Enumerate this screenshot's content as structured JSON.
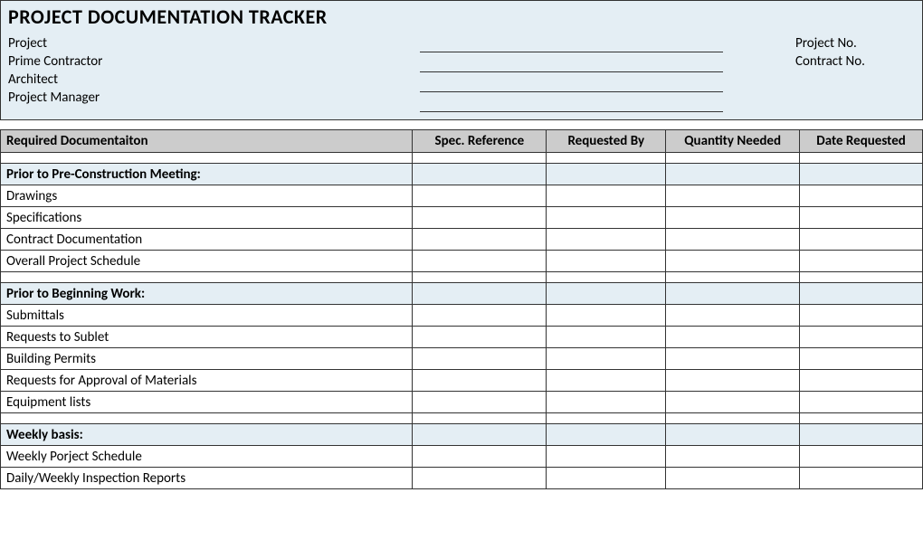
{
  "header": {
    "title": "PROJECT DOCUMENTATION TRACKER",
    "labels": {
      "project": "Project",
      "prime_contractor": "Prime Contractor",
      "architect": "Architect",
      "project_manager": "Project Manager",
      "project_no": "Project No.",
      "contract_no": "Contract No."
    },
    "values": {
      "project": "",
      "prime_contractor": "",
      "architect": "",
      "project_manager": "",
      "project_no": "",
      "contract_no": ""
    }
  },
  "columns": {
    "doc": "Required Documentaiton",
    "spec": "Spec. Reference",
    "reqby": "Requested By",
    "qty": "Quantity Needed",
    "date": "Date Requested"
  },
  "sections": [
    {
      "heading": "Prior to Pre-Construction Meeting:",
      "items": [
        "Drawings",
        "Specifications",
        "Contract Documentation",
        "Overall Project Schedule"
      ]
    },
    {
      "heading": "Prior to Beginning Work:",
      "items": [
        "Submittals",
        "Requests to Sublet",
        "Building Permits",
        "Requests for Approval of Materials",
        "Equipment lists"
      ]
    },
    {
      "heading": "Weekly basis:",
      "items": [
        "Weekly Porject Schedule",
        "Daily/Weekly Inspection Reports"
      ]
    }
  ]
}
